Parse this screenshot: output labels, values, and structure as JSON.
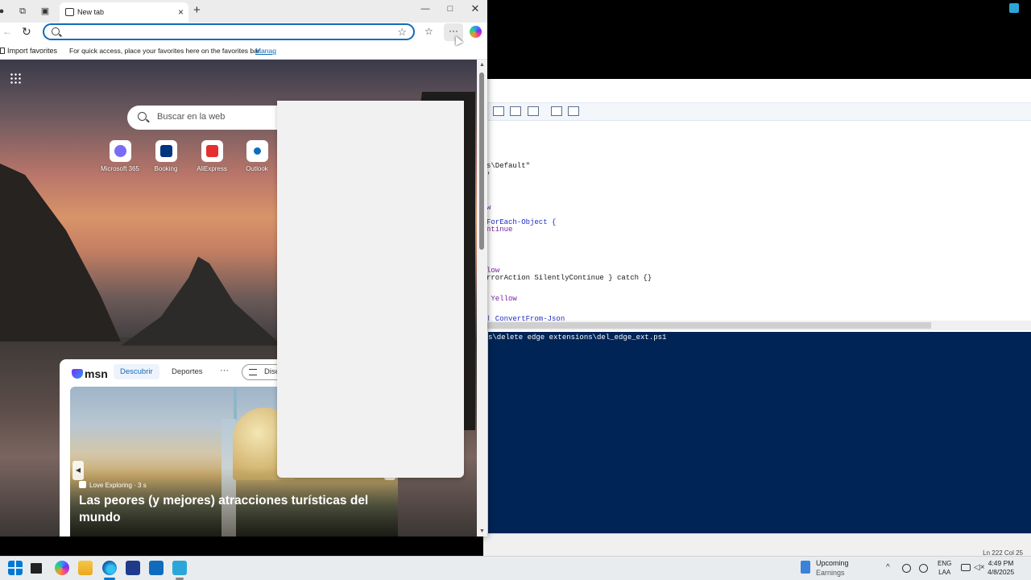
{
  "browser": {
    "tab_title": "New tab",
    "address_placeholder": "",
    "favorites_bar": {
      "import_label": "Import favorites",
      "hint": "For quick access, place your favorites here on the favorites bar.",
      "manage_link": "Manag"
    }
  },
  "newtab": {
    "search_placeholder": "Buscar en la web",
    "quick_links": [
      {
        "label": "Microsoft 365",
        "icon": "microsoft-365-icon",
        "color": "#7b6cf5"
      },
      {
        "label": "Booking",
        "icon": "booking-icon",
        "color": "#003580"
      },
      {
        "label": "AliExpress",
        "icon": "aliexpress-icon",
        "color": "#e62e2e"
      },
      {
        "label": "Outlook",
        "icon": "outlook-icon",
        "color": "#0f6cbd"
      }
    ],
    "msn": {
      "logo": "msn",
      "tabs": [
        "Descubrir",
        "Deportes"
      ],
      "more": "···",
      "personalize": "Dise"
    },
    "news": {
      "source": "Love Exploring · 3 s",
      "headline": "Las peores (y mejores) atracciones turísticas del mundo"
    }
  },
  "ise": {
    "code_lines": [
      {
        "text": "s\\Default\""
      },
      {
        "text": "'"
      },
      {
        "text": "w"
      },
      {
        "text": "ForEach-Object {"
      },
      {
        "text": "ntinue"
      },
      {
        "text": "low"
      },
      {
        "text": "rrorAction SilentlyContinue } catch {}"
      },
      {
        "text": " Yellow"
      },
      {
        "text": "| ConvertFrom-Json"
      }
    ],
    "console_line": "s\\delete edge extensions\\del_edge_ext.ps1",
    "status_position": "Ln 222  Col 25"
  },
  "taskbar": {
    "weather_title": "Upcoming",
    "weather_sub": "Earnings",
    "lang_line1": "ENG",
    "lang_line2": "LAA",
    "time": "4:49 PM",
    "date": "4/8/2025"
  },
  "colors": {
    "accent": "#0f6cbd",
    "console_bg": "#012456"
  }
}
